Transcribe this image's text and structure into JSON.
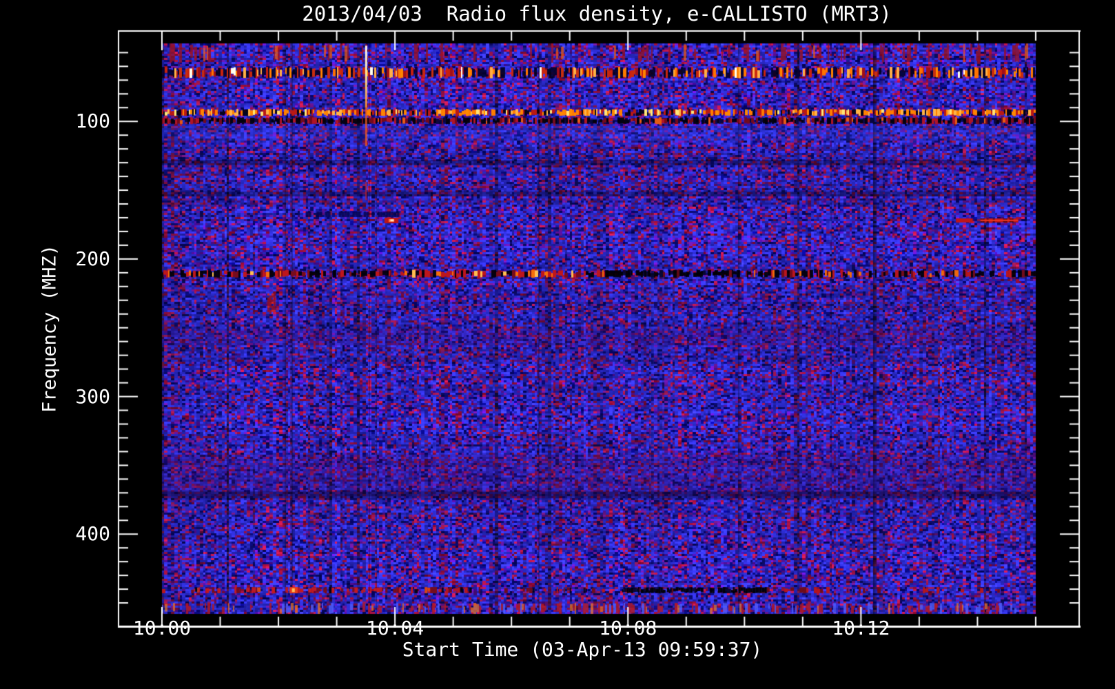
{
  "figure": {
    "background_color": "#000000",
    "frame_color": "#ffffff",
    "text_color": "#ffffff"
  },
  "chart_data": {
    "type": "heatmap",
    "subtype": "radio-spectrogram",
    "title": "2013/04/03  Radio flux density, e-CALLISTO (MRT3)",
    "xlabel": "Start Time (03-Apr-13 09:59:37)",
    "ylabel": "Frequency (MHZ)",
    "x_axis": {
      "tick_labels": [
        "10:00",
        "10:04",
        "10:08",
        "10:12"
      ],
      "major_tick_minutes": [
        0,
        4,
        8,
        12
      ],
      "minor_tick_step_minutes": 1,
      "span_minutes": 15
    },
    "y_axis": {
      "unit": "MHZ",
      "major_ticks": [
        100,
        200,
        300,
        400
      ],
      "tick_labels": [
        "100",
        "200",
        "300",
        "400"
      ],
      "minor_tick_step": 10,
      "freq_top_mhz": 43.3,
      "freq_bottom_mhz": 458,
      "direction": "increasing-downward"
    },
    "x_ticks": [
      {
        "label": "10:00",
        "t": 0
      },
      {
        "label": "10:04",
        "t": 4
      },
      {
        "label": "10:08",
        "t": 8
      },
      {
        "label": "10:12",
        "t": 12
      }
    ],
    "y_ticks": [
      {
        "label": "100",
        "f": 100
      },
      {
        "label": "200",
        "f": 200
      },
      {
        "label": "300",
        "f": 300
      },
      {
        "label": "400",
        "f": 400
      }
    ],
    "legend": "none",
    "grid": "off",
    "background_field": "blue noise (quiet solar radio background)",
    "bands": [
      {
        "freq_mhz": [
          43.3,
          57
        ],
        "style": "red_mottle"
      },
      {
        "freq_mhz": [
          60.5,
          68.5
        ],
        "style": "bright_speckle"
      },
      {
        "freq_mhz": [
          91,
          96
        ],
        "style": "dense_orange"
      },
      {
        "freq_mhz": [
          97,
          102
        ],
        "style": "dark_red"
      },
      {
        "freq_mhz": [
          103,
          114
        ],
        "style": "light_blue_tint"
      },
      {
        "freq_mhz": [
          128,
          131.5
        ],
        "style": "dim"
      },
      {
        "freq_mhz": [
          151,
          154.5
        ],
        "style": "dim"
      },
      {
        "freq_mhz": [
          208,
          213.5
        ],
        "style": "red_black_speckle",
        "segments": [
          {
            "t": [
              0,
              7.63
            ],
            "w": "mixed"
          },
          {
            "t": [
              7.63,
              9.7
            ],
            "w": "black"
          },
          {
            "t": [
              9.7,
              15
            ],
            "w": "mixed2"
          }
        ]
      },
      {
        "freq_mhz": [
          251,
          263
        ],
        "style": "purple_tint"
      },
      {
        "freq_mhz": [
          342,
          373
        ],
        "style": "purple_tint"
      },
      {
        "freq_mhz": [
          369,
          374
        ],
        "style": "dim"
      },
      {
        "freq_mhz": [
          438.5,
          443
        ],
        "style": "red_line",
        "segments": [
          {
            "t": [
              0,
              0.5
            ],
            "w": "sparse"
          },
          {
            "t": [
              0.5,
              4.8
            ],
            "w": "red_mix"
          },
          {
            "t": [
              4.8,
              7.9
            ],
            "w": "sparse"
          },
          {
            "t": [
              7.9,
              10.4
            ],
            "w": "black"
          },
          {
            "t": [
              10.4,
              15
            ],
            "w": "sparse2"
          }
        ]
      },
      {
        "freq_mhz": [
          450,
          458
        ],
        "style": "bottom_bright"
      }
    ],
    "features": [
      {
        "type": "bright_vertical_streak",
        "t_min": 3.5,
        "freq_mhz": [
          45,
          157
        ]
      },
      {
        "type": "dark_blue_dash",
        "t_min": [
          2.42,
          4.08
        ],
        "freq_mhz": [
          165.5,
          169.5
        ]
      },
      {
        "type": "red_dash",
        "t_min": [
          3.82,
          4.06
        ],
        "freq_mhz": [
          170,
          174
        ],
        "bright_core": true
      },
      {
        "type": "red_dash",
        "t_min": [
          13.63,
          13.92
        ],
        "freq_mhz": [
          170.5,
          173.5
        ]
      },
      {
        "type": "red_dash",
        "t_min": [
          14.05,
          14.7
        ],
        "freq_mhz": [
          170.5,
          173.5
        ],
        "gapped": true
      },
      {
        "type": "red_blob",
        "t_min": [
          1.81,
          1.93
        ],
        "freq_mhz": [
          225,
          240
        ]
      },
      {
        "type": "bright_spot",
        "t_min": [
          2.19,
          2.33
        ],
        "freq_mhz": [
          438.5,
          443
        ]
      }
    ],
    "palette": {
      "blue": "#2222dd",
      "blue_bright": "#3a3af8",
      "blue_dark": "#12129a",
      "navy": "#060668",
      "purple": "#5a1a9a",
      "violet": "#7a2090",
      "red_dark": "#7a0f2a",
      "red": "#b51430",
      "red_bright": "#e03020",
      "orange": "#ff7b00",
      "amber": "#ffb347",
      "yellow": "#ffe06a",
      "white": "#ffffff",
      "black": "#000000"
    }
  }
}
